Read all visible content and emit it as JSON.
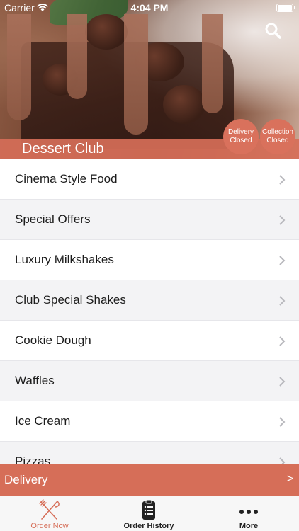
{
  "status_bar": {
    "carrier": "Carrier",
    "time": "4:04 PM"
  },
  "header": {
    "title": "Dessert Club",
    "search_icon": "search-icon",
    "badges": {
      "delivery": {
        "line1": "Delivery",
        "line2": "Closed"
      },
      "collection": {
        "line1": "Collection",
        "line2": "Closed"
      }
    }
  },
  "menu": {
    "items": [
      {
        "label": "Cinema Style Food"
      },
      {
        "label": "Special Offers"
      },
      {
        "label": "Luxury Milkshakes"
      },
      {
        "label": "Club Special Shakes"
      },
      {
        "label": "Cookie Dough"
      },
      {
        "label": "Waffles"
      },
      {
        "label": "Ice Cream"
      },
      {
        "label": "Pizzas"
      }
    ]
  },
  "delivery_bar": {
    "label": "Delivery",
    "arrow": ">"
  },
  "tabbar": {
    "tabs": [
      {
        "label": "Order Now",
        "icon": "fork-knife-icon",
        "active": true
      },
      {
        "label": "Order History",
        "icon": "clipboard-list-icon",
        "active": false
      },
      {
        "label": "More",
        "icon": "more-dots-icon",
        "active": false
      }
    ]
  },
  "colors": {
    "accent": "#d66e58",
    "tab_active": "#d66e58"
  }
}
